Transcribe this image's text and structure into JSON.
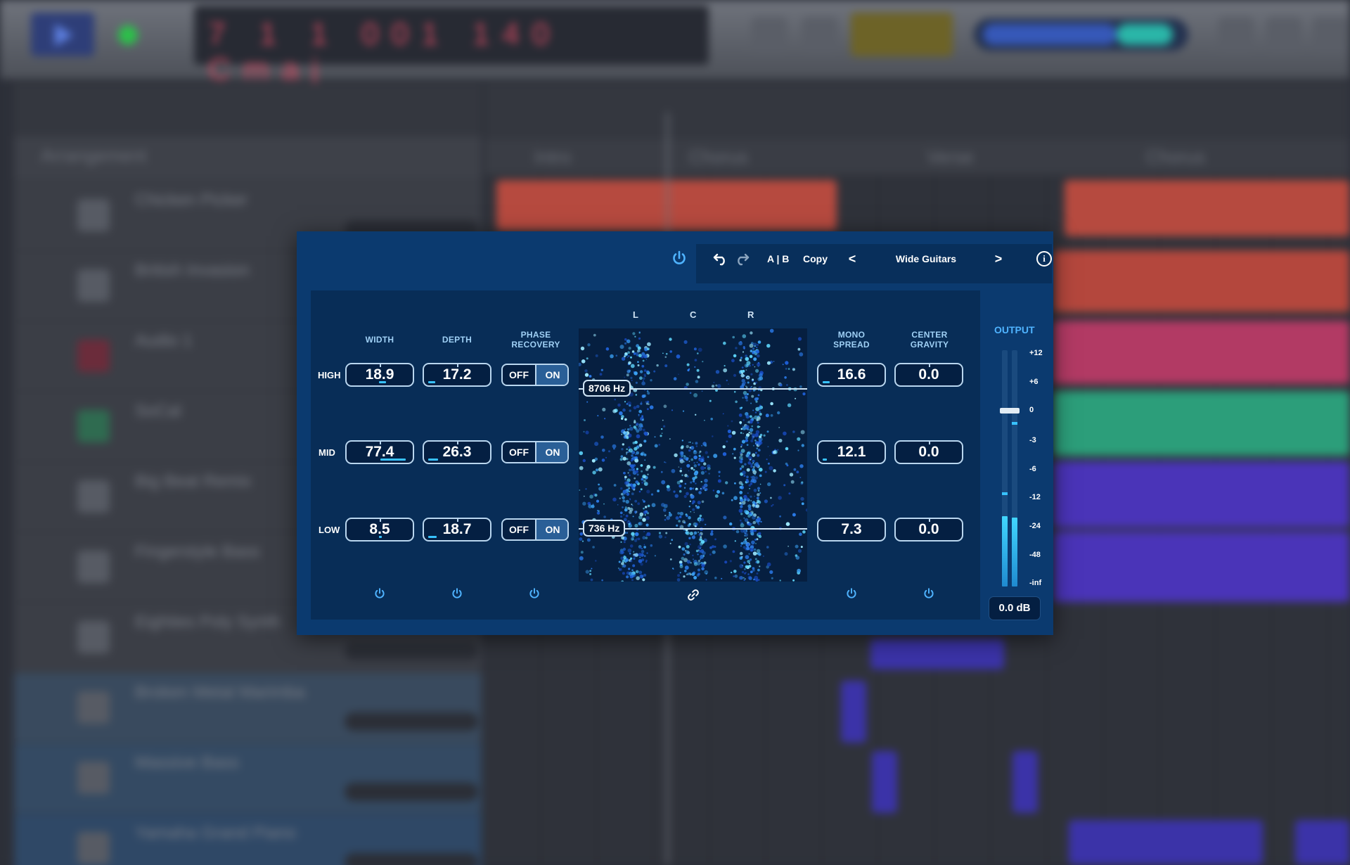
{
  "plugin": {
    "toolbar": {
      "ab_label": "A | B",
      "copy_label": "Copy",
      "preset_name": "Wide Guitars",
      "prev_label": "<",
      "next_label": ">",
      "info_label": "i"
    },
    "columns": {
      "width": "WIDTH",
      "depth": "DEPTH",
      "phase_recovery": "PHASE RECOVERY",
      "mono_spread": "MONO SPREAD",
      "center_gravity": "CENTER GRAVITY"
    },
    "bands": [
      {
        "label": "HIGH",
        "width": "18.9",
        "depth": "17.2",
        "phase_off": "OFF",
        "phase_on": "ON",
        "mono_spread": "16.6",
        "center_gravity": "0.0"
      },
      {
        "label": "MID",
        "width": "77.4",
        "depth": "26.3",
        "phase_off": "OFF",
        "phase_on": "ON",
        "mono_spread": "12.1",
        "center_gravity": "0.0"
      },
      {
        "label": "LOW",
        "width": "8.5",
        "depth": "18.7",
        "phase_off": "OFF",
        "phase_on": "ON",
        "mono_spread": "7.3",
        "center_gravity": "0.0"
      }
    ],
    "scope": {
      "left_label": "L",
      "center_label": "C",
      "right_label": "R",
      "high_crossover": "8706 Hz",
      "low_crossover": "736 Hz"
    },
    "output": {
      "label": "OUTPUT",
      "scale": [
        "+12",
        "+6",
        "0",
        "-3",
        "-6",
        "-12",
        "-24",
        "-48",
        "-inf"
      ],
      "value": "0.0 dB"
    },
    "colors": {
      "background": "#0b3a6f",
      "accent": "#4fb3ff",
      "meter": "#38c2ff"
    }
  },
  "daw": {
    "arrangement_label": "Arrangement",
    "lcd_text": "7 1 1 001 140 Cmaj",
    "markers": [
      "Intro",
      "Chorus",
      "Verse",
      "Chorus"
    ],
    "tracks": [
      "Chicken Picker",
      "British Invasion",
      "Audio 1",
      "SoCal",
      "Big Beat Remix",
      "Fingerstyle Bass",
      "Eighties Poly Synth",
      "Broken Metal Marimba",
      "Massive Bass",
      "Yamaha Grand Piano"
    ]
  }
}
